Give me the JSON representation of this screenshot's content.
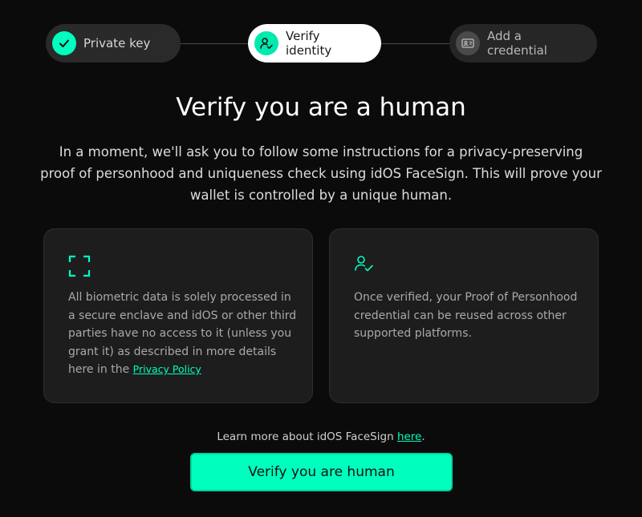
{
  "stepper": {
    "steps": [
      {
        "label": "Private key",
        "state": "completed",
        "icon": "check-icon"
      },
      {
        "label": "Verify identity",
        "state": "active",
        "icon": "user-check-icon"
      },
      {
        "label": "Add a credential",
        "state": "pending",
        "icon": "id-card-icon"
      }
    ]
  },
  "main": {
    "title": "Verify you are a human",
    "intro": "In a moment, we'll ask you to follow some instructions for a privacy-preserving proof of personhood and uniqueness check using idOS FaceSign. This will prove your wallet is controlled by a unique human."
  },
  "cards": {
    "privacy": {
      "icon": "face-scan-icon",
      "text": "All biometric data is solely processed in a secure enclave and idOS or other third parties have no access to it (unless you grant it) as described in more details here in the ",
      "link_label": "Privacy Policy"
    },
    "reuse": {
      "icon": "user-check-icon",
      "text": "Once verified, your Proof of Personhood credential can be reused across other supported platforms."
    }
  },
  "footer": {
    "learn_more_prefix": "Learn more about idOS FaceSign ",
    "learn_more_link": "here",
    "learn_more_suffix": ".",
    "cta_label": "Verify you are human"
  },
  "colors": {
    "accent": "#00ffbe",
    "background": "#0b0b0b",
    "card": "#1d1d1d"
  }
}
